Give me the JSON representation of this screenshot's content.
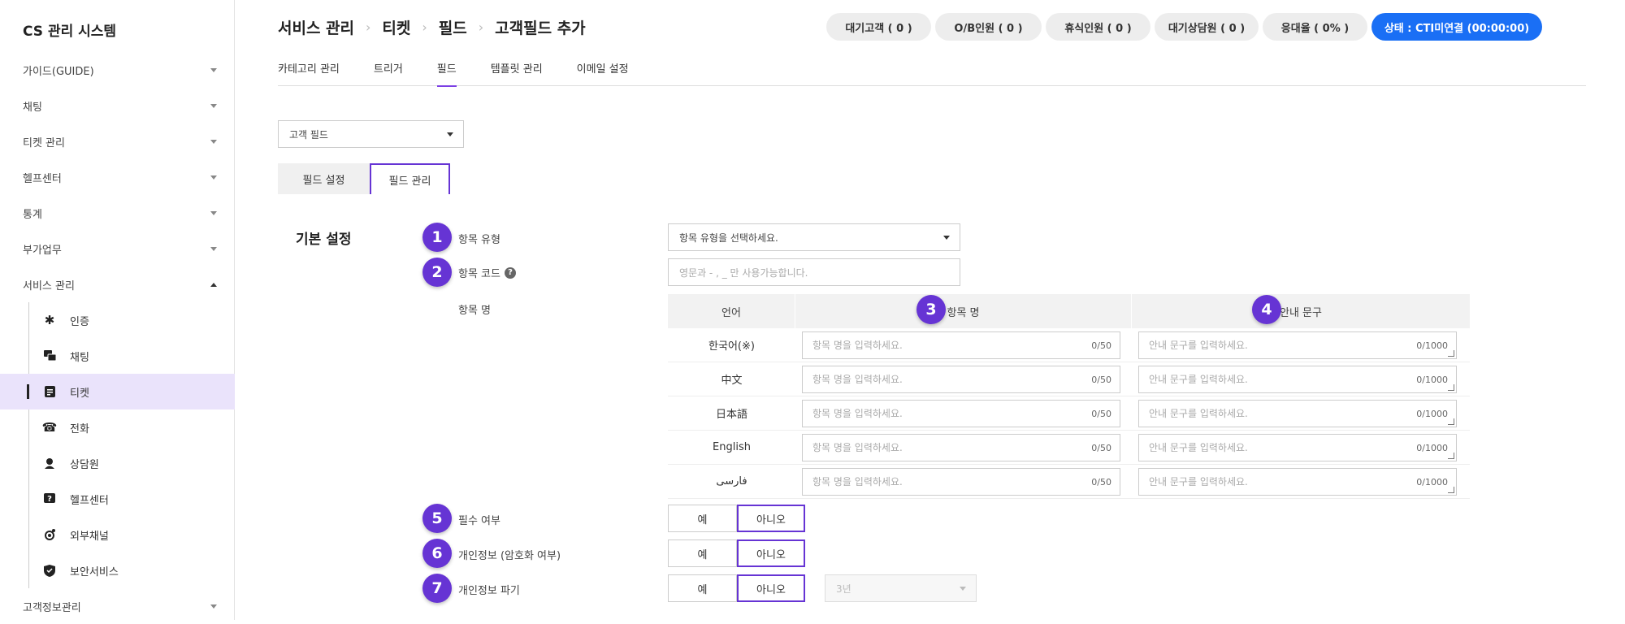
{
  "sidebar": {
    "title": "CS 관리 시스템",
    "menu": [
      {
        "label": "가이드(GUIDE)"
      },
      {
        "label": "채팅"
      },
      {
        "label": "티켓 관리"
      },
      {
        "label": "헬프센터"
      },
      {
        "label": "통계"
      },
      {
        "label": "부가업무"
      },
      {
        "label": "서비스 관리"
      }
    ],
    "submenu": [
      {
        "label": "인증",
        "icon": "gear-icon"
      },
      {
        "label": "채팅",
        "icon": "chat-icon"
      },
      {
        "label": "티켓",
        "icon": "ticket-icon"
      },
      {
        "label": "전화",
        "icon": "phone-icon"
      },
      {
        "label": "상담원",
        "icon": "agent-icon"
      },
      {
        "label": "헬프센터",
        "icon": "help-center-icon"
      },
      {
        "label": "외부채널",
        "icon": "external-channel-icon"
      },
      {
        "label": "보안서비스",
        "icon": "shield-icon"
      }
    ],
    "last_item": "고객정보관리"
  },
  "breadcrumb": [
    "서비스 관리",
    "티켓",
    "필드",
    "고객필드 추가"
  ],
  "status": [
    "대기고객 ( 0 )",
    "O/B인원 ( 0 )",
    "휴식인원 ( 0 )",
    "대기상담원 ( 0 )",
    "응대율 ( 0% )",
    "상태 : CTI미연결 (00:00:00)"
  ],
  "tabs": [
    "카테고리 관리",
    "트리거",
    "필드",
    "템플릿 관리",
    "이메일 설정"
  ],
  "field_type_select": "고객 필드",
  "sub_tabs": [
    "필드 설정",
    "필드 관리"
  ],
  "section_title": "기본 설정",
  "form": {
    "item_type_label": "항목 유형",
    "item_type_placeholder": "항목 유형을 선택하세요.",
    "item_code_label": "항목 코드",
    "item_code_help": "?",
    "item_code_placeholder": "영문과 - , _ 만 사용가능합니다.",
    "item_name_label": "항목 명",
    "table_headers": [
      "언어",
      "항목 명",
      "안내 문구"
    ],
    "name_placeholder": "항목 명을 입력하세요.",
    "name_count": "0/50",
    "guide_placeholder": "안내 문구를 입력하세요.",
    "guide_count": "0/1000",
    "languages": [
      "한국어(※)",
      "中文",
      "日本語",
      "English",
      "فارسی"
    ],
    "required_label": "필수 여부",
    "privacy_label": "개인정보 (암호화 여부)",
    "destroy_label": "개인정보 파기",
    "yes": "예",
    "no": "아니오",
    "period": "3년"
  },
  "badges": [
    "1",
    "2",
    "3",
    "4",
    "5",
    "6",
    "7"
  ],
  "colors": {
    "accent": "#6634d4",
    "brand_blue": "#1a6ff5",
    "active_bg": "#eae3fb"
  }
}
